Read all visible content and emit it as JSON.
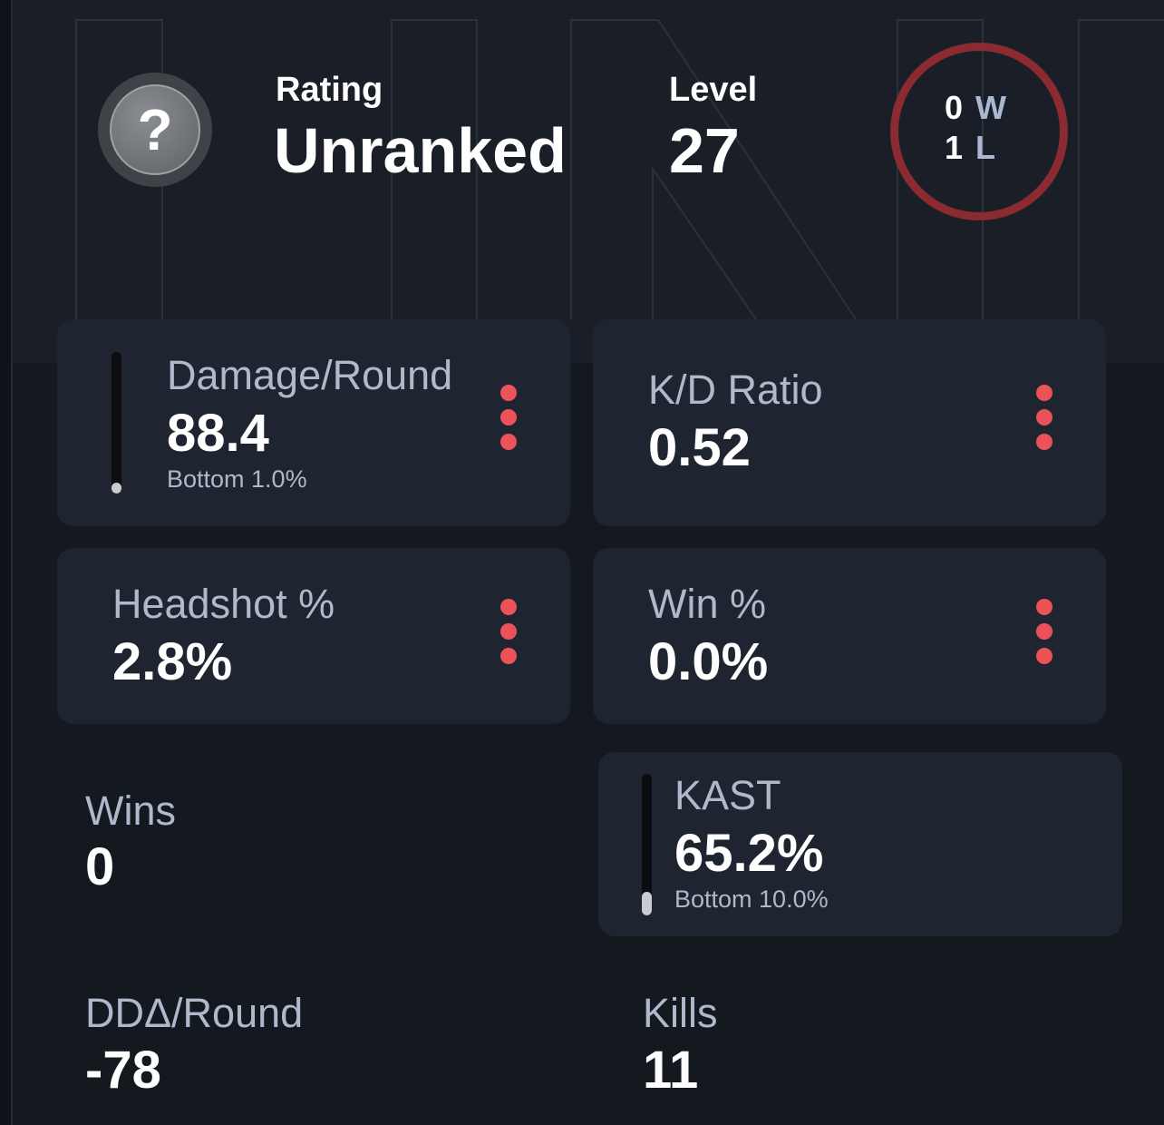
{
  "header": {
    "rank_icon": "question-mark-icon",
    "rating_label": "Rating",
    "rating_value": "Unranked",
    "level_label": "Level",
    "level_value": "27",
    "wins_count": "0",
    "wins_letter": "W",
    "losses_count": "1",
    "losses_letter": "L"
  },
  "stats": {
    "damage_round": {
      "label": "Damage/Round",
      "value": "88.4",
      "sub": "Bottom 1.0%",
      "percentile_fill": 0.01
    },
    "kd_ratio": {
      "label": "K/D Ratio",
      "value": "0.52"
    },
    "headshot": {
      "label": "Headshot %",
      "value": "2.8%"
    },
    "win_pct": {
      "label": "Win %",
      "value": "0.0%"
    },
    "wins": {
      "label": "Wins",
      "value": "0"
    },
    "kast": {
      "label": "KAST",
      "value": "65.2%",
      "sub": "Bottom 10.0%",
      "percentile_fill": 0.1
    },
    "dda_round": {
      "label": "DDΔ/Round",
      "value": "-78"
    },
    "kills": {
      "label": "Kills",
      "value": "11"
    }
  },
  "colors": {
    "accent_dots": "#ec5359",
    "ring": "#8b2a30",
    "background": "#141920",
    "card": "#1f2530"
  }
}
